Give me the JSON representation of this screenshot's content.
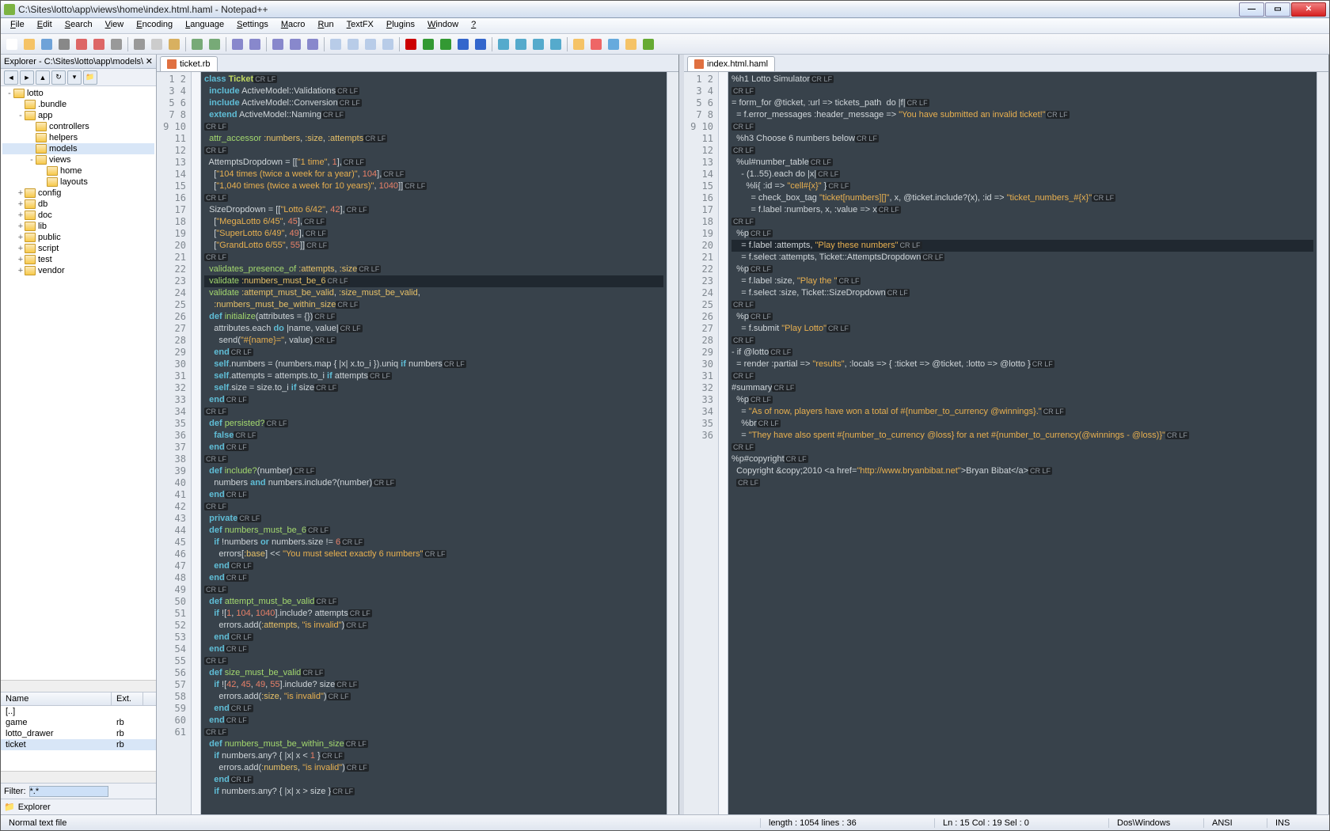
{
  "titlebar": {
    "text": "C:\\Sites\\lotto\\app\\views\\home\\index.html.haml - Notepad++"
  },
  "winbtns": {
    "min": "—",
    "max": "▭",
    "close": "✕"
  },
  "menu": [
    "File",
    "Edit",
    "Search",
    "View",
    "Encoding",
    "Language",
    "Settings",
    "Macro",
    "Run",
    "TextFX",
    "Plugins",
    "Window",
    "?"
  ],
  "explorer": {
    "title": "Explorer - C:\\Sites\\lotto\\app\\models\\",
    "tree": [
      {
        "d": 0,
        "t": "-",
        "n": "lotto"
      },
      {
        "d": 1,
        "t": "",
        "n": ".bundle"
      },
      {
        "d": 1,
        "t": "-",
        "n": "app"
      },
      {
        "d": 2,
        "t": "",
        "n": "controllers"
      },
      {
        "d": 2,
        "t": "",
        "n": "helpers"
      },
      {
        "d": 2,
        "t": "",
        "n": "models",
        "sel": true
      },
      {
        "d": 2,
        "t": "-",
        "n": "views"
      },
      {
        "d": 3,
        "t": "",
        "n": "home"
      },
      {
        "d": 3,
        "t": "",
        "n": "layouts"
      },
      {
        "d": 1,
        "t": "+",
        "n": "config"
      },
      {
        "d": 1,
        "t": "+",
        "n": "db"
      },
      {
        "d": 1,
        "t": "+",
        "n": "doc"
      },
      {
        "d": 1,
        "t": "+",
        "n": "lib"
      },
      {
        "d": 1,
        "t": "+",
        "n": "public"
      },
      {
        "d": 1,
        "t": "+",
        "n": "script"
      },
      {
        "d": 1,
        "t": "+",
        "n": "test"
      },
      {
        "d": 1,
        "t": "+",
        "n": "vendor"
      }
    ],
    "cols": {
      "name": "Name",
      "ext": "Ext."
    },
    "files": [
      {
        "n": "[..]",
        "e": ""
      },
      {
        "n": "game",
        "e": "rb"
      },
      {
        "n": "lotto_drawer",
        "e": "rb"
      },
      {
        "n": "ticket",
        "e": "rb",
        "sel": true
      }
    ],
    "filter_label": "Filter:",
    "filter_value": "*.*",
    "bottom_tab": "Explorer"
  },
  "tabs": {
    "left": "ticket.rb",
    "right": "index.html.haml"
  },
  "left_lines": [
    "<span class='kw'>class</span> <span class='cls'>Ticket</span><span class='crlf'>CR LF</span>",
    "  <span class='kw'>include</span> ActiveModel::Validations<span class='crlf'>CR LF</span>",
    "  <span class='kw'>include</span> ActiveModel::Conversion<span class='crlf'>CR LF</span>",
    "  <span class='kw'>extend</span> ActiveModel::Naming<span class='crlf'>CR LF</span>",
    "<span class='crlf'>CR LF</span>",
    "  <span class='kw2'>attr_accessor</span> <span class='sym'>:numbers</span>, <span class='sym'>:size</span>, <span class='sym'>:attempts</span><span class='crlf'>CR LF</span>",
    "<span class='crlf'>CR LF</span>",
    "  AttemptsDropdown <span class='op'>=</span> [[<span class='str'>\"1 time\"</span>, <span class='num'>1</span>],<span class='crlf'>CR LF</span>",
    "    [<span class='str'>\"104 times (twice a week for a year)\"</span>, <span class='num'>104</span>],<span class='crlf'>CR LF</span>",
    "    [<span class='str'>\"1,040 times (twice a week for 10 years)\"</span>, <span class='num'>1040</span>]]<span class='crlf'>CR LF</span>",
    "<span class='crlf'>CR LF</span>",
    "  SizeDropdown <span class='op'>=</span> [[<span class='str'>\"Lotto 6/42\"</span>, <span class='num'>42</span>],<span class='crlf'>CR LF</span>",
    "    [<span class='str'>\"MegaLotto 6/45\"</span>, <span class='num'>45</span>],<span class='crlf'>CR LF</span>",
    "    [<span class='str'>\"SuperLotto 6/49\"</span>, <span class='num'>49</span>],<span class='crlf'>CR LF</span>",
    "    [<span class='str'>\"GrandLotto 6/55\"</span>, <span class='num'>55</span>]]<span class='crlf'>CR LF</span>",
    "<span class='crlf'>CR LF</span>",
    "  <span class='kw2'>validates_presence_of</span> <span class='sym'>:attempts</span>, <span class='sym'>:size</span><span class='crlf'>CR LF</span>",
    "<span class='currentline'>  <span class='kw2'>validate</span> <span class='sym'>:numbers_must_be_6</span><span class='crlf'>CR LF</span></span>",
    "  <span class='kw2'>validate</span> <span class='sym'>:attempt_must_be_valid</span>, <span class='sym'>:size_must_be_valid</span>,",
    "    <span class='sym'>:numbers_must_be_within_size</span><span class='crlf'>CR LF</span>",
    "  <span class='kw'>def</span> <span class='kw2'>initialize</span>(attributes = {})<span class='crlf'>CR LF</span>",
    "    attributes.each <span class='kw'>do</span> |name, value|<span class='crlf'>CR LF</span>",
    "      send(<span class='str'>\"#{name}=\"</span>, value)<span class='crlf'>CR LF</span>",
    "    <span class='kw'>end</span><span class='crlf'>CR LF</span>",
    "    <span class='kw'>self</span>.numbers = (numbers.map { |x| x.to_i }).uniq <span class='kw'>if</span> numbers<span class='crlf'>CR LF</span>",
    "    <span class='kw'>self</span>.attempts = attempts.to_i <span class='kw'>if</span> attempts<span class='crlf'>CR LF</span>",
    "    <span class='kw'>self</span>.size = size.to_i <span class='kw'>if</span> size<span class='crlf'>CR LF</span>",
    "  <span class='kw'>end</span><span class='crlf'>CR LF</span>",
    "<span class='crlf'>CR LF</span>",
    "  <span class='kw'>def</span> <span class='kw2'>persisted?</span><span class='crlf'>CR LF</span>",
    "    <span class='kw'>false</span><span class='crlf'>CR LF</span>",
    "  <span class='kw'>end</span><span class='crlf'>CR LF</span>",
    "<span class='crlf'>CR LF</span>",
    "  <span class='kw'>def</span> <span class='kw2'>include?</span>(number)<span class='crlf'>CR LF</span>",
    "    numbers <span class='kw'>and</span> numbers.include?(number)<span class='crlf'>CR LF</span>",
    "  <span class='kw'>end</span><span class='crlf'>CR LF</span>",
    "<span class='crlf'>CR LF</span>",
    "  <span class='kw'>private</span><span class='crlf'>CR LF</span>",
    "  <span class='kw'>def</span> <span class='kw2'>numbers_must_be_6</span><span class='crlf'>CR LF</span>",
    "    <span class='kw'>if</span> !numbers <span class='kw'>or</span> numbers.size != <span class='num'>6</span><span class='crlf'>CR LF</span>",
    "      errors[<span class='sym'>:base</span>] &lt;&lt; <span class='str'>\"You must select exactly 6 numbers\"</span><span class='crlf'>CR LF</span>",
    "    <span class='kw'>end</span><span class='crlf'>CR LF</span>",
    "  <span class='kw'>end</span><span class='crlf'>CR LF</span>",
    "<span class='crlf'>CR LF</span>",
    "  <span class='kw'>def</span> <span class='kw2'>attempt_must_be_valid</span><span class='crlf'>CR LF</span>",
    "    <span class='kw'>if</span> ![<span class='num'>1</span>, <span class='num'>104</span>, <span class='num'>1040</span>].include? attempts<span class='crlf'>CR LF</span>",
    "      errors.add(<span class='sym'>:attempts</span>, <span class='str'>\"is invalid\"</span>)<span class='crlf'>CR LF</span>",
    "    <span class='kw'>end</span><span class='crlf'>CR LF</span>",
    "  <span class='kw'>end</span><span class='crlf'>CR LF</span>",
    "<span class='crlf'>CR LF</span>",
    "  <span class='kw'>def</span> <span class='kw2'>size_must_be_valid</span><span class='crlf'>CR LF</span>",
    "    <span class='kw'>if</span> ![<span class='num'>42</span>, <span class='num'>45</span>, <span class='num'>49</span>, <span class='num'>55</span>].include? size<span class='crlf'>CR LF</span>",
    "      errors.add(<span class='sym'>:size</span>, <span class='str'>\"is invalid\"</span>)<span class='crlf'>CR LF</span>",
    "    <span class='kw'>end</span><span class='crlf'>CR LF</span>",
    "  <span class='kw'>end</span><span class='crlf'>CR LF</span>",
    "<span class='crlf'>CR LF</span>",
    "  <span class='kw'>def</span> <span class='kw2'>numbers_must_be_within_size</span><span class='crlf'>CR LF</span>",
    "    <span class='kw'>if</span> numbers.any? { |x| x &lt; <span class='num'>1</span> }<span class='crlf'>CR LF</span>",
    "      errors.add(<span class='sym'>:numbers</span>, <span class='str'>\"is invalid\"</span>)<span class='crlf'>CR LF</span>",
    "    <span class='kw'>end</span><span class='crlf'>CR LF</span>",
    "    <span class='kw'>if</span> numbers.any? { |x| x &gt; size }<span class='crlf'>CR LF</span>"
  ],
  "right_lines": [
    "%h1 Lotto Simulator<span class='crlf'>CR LF</span>",
    "<span class='crlf'>CR LF</span>",
    "= form_for @ticket, :url =&gt; tickets_path  do |f|<span class='crlf'>CR LF</span>",
    "  = f.error_messages :header_message =&gt; <span class='str'>\"You have submitted an invalid ticket!\"</span><span class='crlf'>CR LF</span>",
    "<span class='crlf'>CR LF</span>",
    "  %h3 Choose 6 numbers below<span class='crlf'>CR LF</span>",
    "<span class='crlf'>CR LF</span>",
    "  %ul#number_table<span class='crlf'>CR LF</span>",
    "    - (1..55).each do |x|<span class='crlf'>CR LF</span>",
    "      %li{ :id =&gt; <span class='str'>\"cell#{x}\"</span> }<span class='crlf'>CR LF</span>",
    "        = check_box_tag <span class='str'>\"ticket[numbers][]\"</span>, x, @ticket.include?(x), :id =&gt; <span class='str'>\"ticket_numbers_#{x}\"</span><span class='crlf'>CR LF</span>",
    "        = f.label :numbers, x, :value =&gt; x<span class='crlf'>CR LF</span>",
    "<span class='crlf'>CR LF</span>",
    "  %p<span class='crlf'>CR LF</span>",
    "<span class='currentline'>    = f.label :attempts, <span class='str'>\"Play these numbers\"</span><span class='crlf'>CR LF</span></span>",
    "    = f.select :attempts, Ticket::AttemptsDropdown<span class='crlf'>CR LF</span>",
    "  %p<span class='crlf'>CR LF</span>",
    "    = f.label :size, <span class='str'>\"Play the \"</span><span class='crlf'>CR LF</span>",
    "    = f.select :size, Ticket::SizeDropdown<span class='crlf'>CR LF</span>",
    "<span class='crlf'>CR LF</span>",
    "  %p<span class='crlf'>CR LF</span>",
    "    = f.submit <span class='str'>\"Play Lotto\"</span><span class='crlf'>CR LF</span>",
    "<span class='crlf'>CR LF</span>",
    "- if @lotto<span class='crlf'>CR LF</span>",
    "  = render :partial =&gt; <span class='str'>\"results\"</span>, :locals =&gt; { :ticket =&gt; @ticket, :lotto =&gt; @lotto }<span class='crlf'>CR LF</span>",
    "<span class='crlf'>CR LF</span>",
    "#summary<span class='crlf'>CR LF</span>",
    "  %p<span class='crlf'>CR LF</span>",
    "    = <span class='str'>\"As of now, players have won a total of #{number_to_currency @winnings}.\"</span><span class='crlf'>CR LF</span>",
    "    %br<span class='crlf'>CR LF</span>",
    "    = <span class='str'>\"They have also spent #{number_to_currency @loss} for a net #{number_to_currency(@winnings - @loss)}\"</span><span class='crlf'>CR LF</span>",
    "<span class='crlf'>CR LF</span>",
    "%p#copyright<span class='crlf'>CR LF</span>",
    "  Copyright &amp;copy;2010 &lt;a href=<span class='str'>\"http://www.bryanbibat.net\"</span>&gt;Bryan Bibat&lt;/a&gt;<span class='crlf'>CR LF</span>",
    "  <span class='crlf'>CR LF</span>",
    ""
  ],
  "status": {
    "left": "Normal text file",
    "len": "length : 1054    lines : 36",
    "pos": "Ln : 15    Col : 19    Sel : 0",
    "eol": "Dos\\Windows",
    "enc": "ANSI",
    "ins": "INS"
  },
  "toolbar_icons": [
    "new",
    "open",
    "save",
    "saveall",
    "close",
    "closeall",
    "print",
    "|",
    "cut",
    "copy",
    "paste",
    "|",
    "undo",
    "redo",
    "|",
    "find",
    "replace",
    "|",
    "zoomin",
    "zoomout",
    "fit",
    "|",
    "wrap",
    "showall",
    "indent",
    "fold",
    "|",
    "rec",
    "play",
    "playfast",
    "stop",
    "stopall",
    "|",
    "sortasc",
    "sortdesc",
    "indentguide",
    "autocomplete",
    "|",
    "settings",
    "heart",
    "help",
    "doc",
    "spellcheck"
  ]
}
